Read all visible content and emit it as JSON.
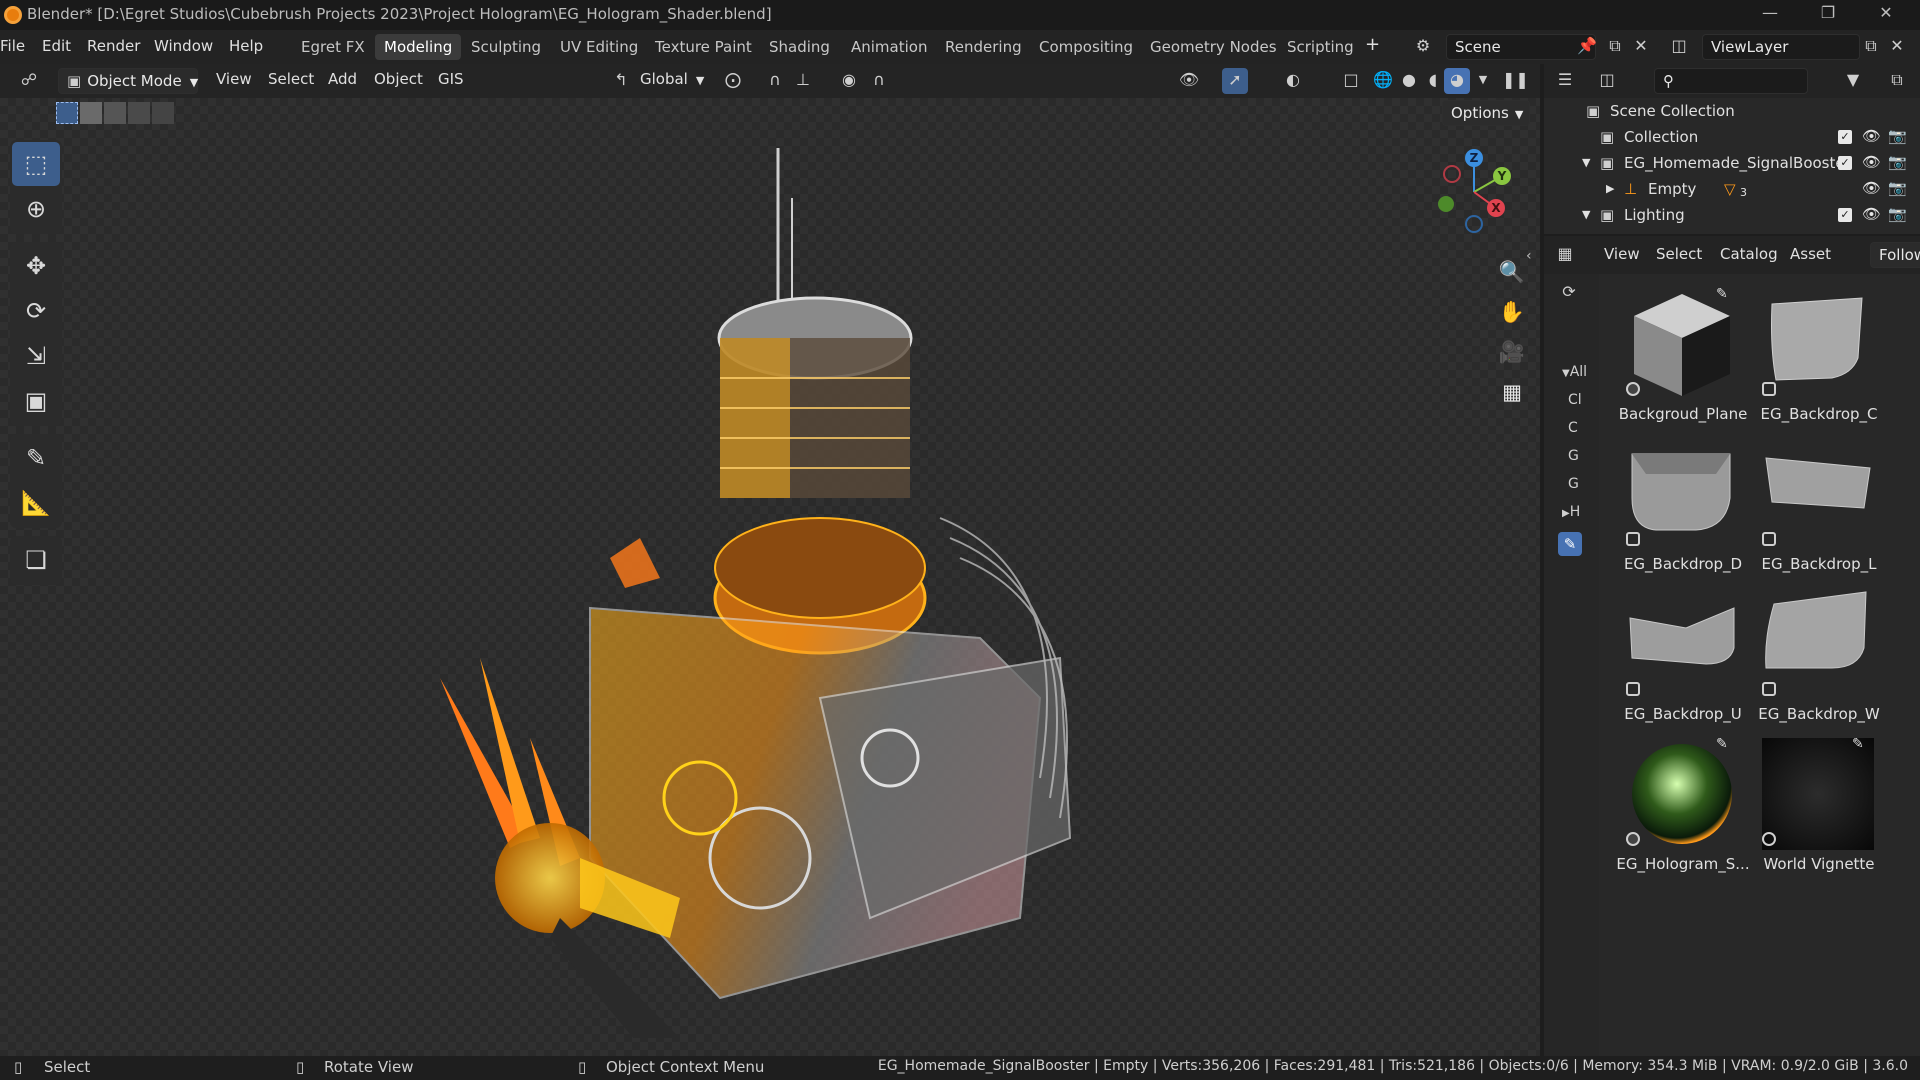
{
  "window": {
    "title": "Blender* [D:\\Egret Studios\\Cubebrush Projects 2023\\Project Hologram\\EG_Hologram_Shader.blend]"
  },
  "menu": [
    "File",
    "Edit",
    "Render",
    "Window",
    "Help"
  ],
  "workspaces": [
    {
      "label": "Egret FX",
      "active": false
    },
    {
      "label": "Modeling",
      "active": true
    },
    {
      "label": "Sculpting",
      "active": false
    },
    {
      "label": "UV Editing",
      "active": false
    },
    {
      "label": "Texture Paint",
      "active": false
    },
    {
      "label": "Shading",
      "active": false
    },
    {
      "label": "Animation",
      "active": false
    },
    {
      "label": "Rendering",
      "active": false
    },
    {
      "label": "Compositing",
      "active": false
    },
    {
      "label": "Geometry Nodes",
      "active": false
    },
    {
      "label": "Scripting",
      "active": false
    }
  ],
  "scene": {
    "name": "Scene",
    "view_layer": "ViewLayer"
  },
  "viewport_header": {
    "mode": "Object Mode",
    "menus": [
      "View",
      "Select",
      "Add",
      "Object",
      "GIS"
    ],
    "orientation": "Global",
    "options": "Options"
  },
  "gizmo": {
    "z": "Z",
    "y": "Y",
    "x": "X"
  },
  "outliner": {
    "root": "Scene Collection",
    "rows": [
      {
        "label": "Collection",
        "indent": 0
      },
      {
        "label": "EG_Homemade_SignalBooster",
        "indent": 0
      },
      {
        "label": "Empty",
        "indent": 1,
        "extra": "3"
      },
      {
        "label": "Lighting",
        "indent": 0
      }
    ]
  },
  "asset_browser": {
    "menus": [
      "View",
      "Select",
      "Catalog",
      "Asset"
    ],
    "follow": "Follow",
    "catalogs": [
      "All",
      "Cl",
      "C",
      "G",
      "G",
      "H"
    ],
    "assets": [
      {
        "name": "Backgroud_Plane",
        "kind": "cube"
      },
      {
        "name": "EG_Backdrop_C",
        "kind": "backdrop"
      },
      {
        "name": "EG_Backdrop_D",
        "kind": "backdrop"
      },
      {
        "name": "EG_Backdrop_L",
        "kind": "backdrop"
      },
      {
        "name": "EG_Backdrop_U",
        "kind": "backdrop"
      },
      {
        "name": "EG_Backdrop_W",
        "kind": "backdrop"
      },
      {
        "name": "EG_Hologram_S...",
        "kind": "sphere"
      },
      {
        "name": "World Vignette",
        "kind": "world"
      }
    ]
  },
  "statusbar": {
    "select": "Select",
    "rotate": "Rotate View",
    "context": "Object Context Menu",
    "stats": "EG_Homemade_SignalBooster | Empty | Verts:356,206 | Faces:291,481 | Tris:521,186 | Objects:0/6 | Memory: 354.3 MiB | VRAM: 0.9/2.0 GiB | 3.6.0"
  },
  "colors": {
    "accent": "#4772b3",
    "active_tool": "#3d5e8c",
    "hologram_orange": "#ff9a1a",
    "hologram_yellow": "#ffd21a",
    "axis_x": "#e0434f",
    "axis_y": "#8ac640",
    "axis_z": "#3b8fe0"
  }
}
